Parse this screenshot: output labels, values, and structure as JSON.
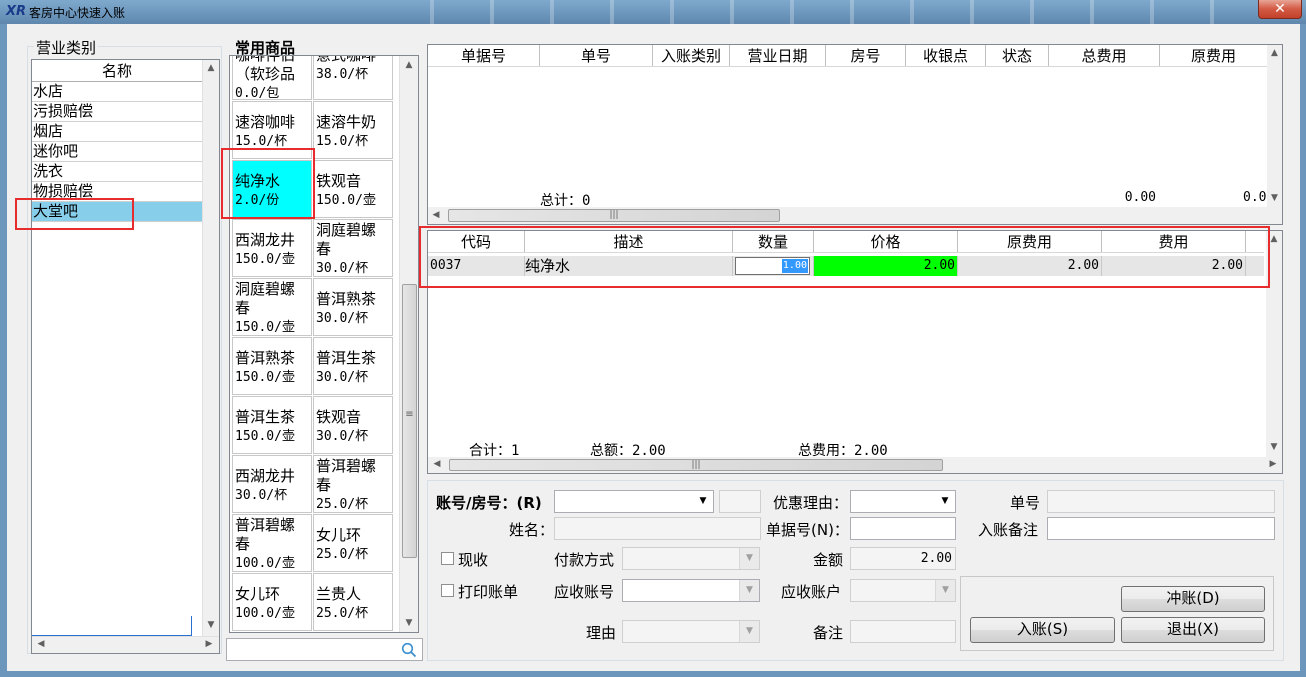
{
  "window": {
    "title": "客房中心快速入账",
    "close_symbol": "✕",
    "logo": "XR"
  },
  "categories": {
    "group_title": "营业类别",
    "column_header": "名称",
    "items": [
      "水店",
      "污损赔偿",
      "烟店",
      "迷你吧",
      "洗衣",
      "物损赔偿",
      "大堂吧"
    ],
    "selected": "大堂吧"
  },
  "products": {
    "group_title": "常用商品",
    "tiles": [
      {
        "name": "咖啡伴侣（软珍品",
        "price": "0.0/包"
      },
      {
        "name": "意式咖啡",
        "price": "38.0/杯"
      },
      {
        "name": "速溶咖啡",
        "price": "15.0/杯"
      },
      {
        "name": "速溶牛奶",
        "price": "15.0/杯"
      },
      {
        "name": "纯净水",
        "price": "2.0/份"
      },
      {
        "name": "铁观音",
        "price": "150.0/壶"
      },
      {
        "name": "西湖龙井",
        "price": "150.0/壶"
      },
      {
        "name": "洞庭碧螺春",
        "price": "30.0/杯"
      },
      {
        "name": "洞庭碧螺春",
        "price": "150.0/壶"
      },
      {
        "name": "普洱熟茶",
        "price": "30.0/杯"
      },
      {
        "name": "普洱熟茶",
        "price": "150.0/壶"
      },
      {
        "name": "普洱生茶",
        "price": "30.0/杯"
      },
      {
        "name": "普洱生茶",
        "price": "150.0/壶"
      },
      {
        "name": "铁观音",
        "price": "30.0/杯"
      },
      {
        "name": "西湖龙井",
        "price": "30.0/杯"
      },
      {
        "name": "普洱碧螺春",
        "price": "25.0/杯"
      },
      {
        "name": "普洱碧螺春",
        "price": "100.0/壶"
      },
      {
        "name": "女儿环",
        "price": "25.0/杯"
      },
      {
        "name": "女儿环",
        "price": "100.0/壶"
      },
      {
        "name": "兰贵人",
        "price": "25.0/杯"
      }
    ],
    "search_placeholder": ""
  },
  "bills_grid": {
    "columns": [
      "单据号",
      "单号",
      "入账类别",
      "营业日期",
      "房号",
      "收银点",
      "状态",
      "总费用",
      "原费用"
    ],
    "summary_label": "总计：0",
    "summary_total": "0.00",
    "summary_orig": "0.0"
  },
  "items_grid": {
    "columns": [
      "代码",
      "描述",
      "数量",
      "价格",
      "原费用",
      "费用"
    ],
    "rows": [
      {
        "code": "0037",
        "desc": "纯净水",
        "qty": "1.00",
        "price": "2.00",
        "orig": "2.00",
        "fee": "2.00"
      }
    ],
    "footer": {
      "count": "合计：1",
      "total": "总额：2.00",
      "fee_total": "总费用：2.00"
    }
  },
  "form": {
    "account_label": "账号/房号：(R)",
    "name_label": "姓名：",
    "cash_label": "现收",
    "print_label": "打印账单",
    "pay_method_label": "付款方式",
    "receivable_no_label": "应收账号",
    "reason_label": "理由",
    "discount_label": "优惠理由：",
    "voucher_label": "单据号(N)：",
    "amount_label": "金额",
    "amount_value": "2.00",
    "receivable_acct_label": "应收账户",
    "remark_label": "备注",
    "order_no_label": "单号",
    "posting_remark_label": "入账备注",
    "reverse_button": "冲账(D)",
    "post_button": "入账(S)",
    "exit_button": "退出(X)"
  }
}
